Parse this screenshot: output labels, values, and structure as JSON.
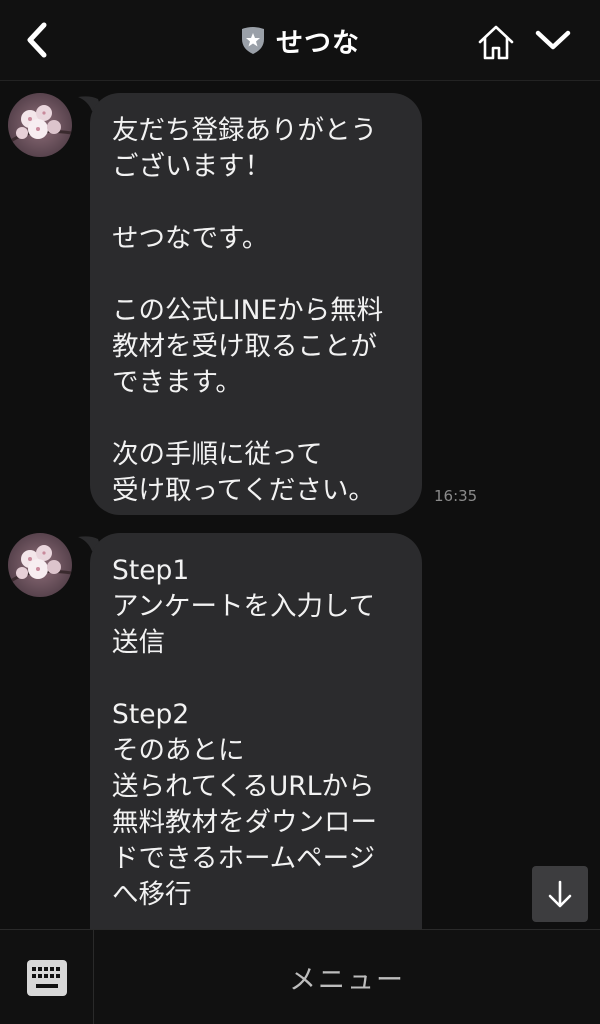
{
  "header": {
    "title": "せつな",
    "icons": {
      "back": "chevron-left-icon",
      "badge": "star-shield-icon",
      "home": "home-icon",
      "expand": "chevron-down-icon"
    }
  },
  "messages": [
    {
      "text": "友だち登録ありがとう\nございます！\n\nせつなです。\n\nこの公式LINEから無料\n教材を受け取ることが\nできます。\n\n次の手順に従って\n受け取ってください。",
      "time": "16:35"
    },
    {
      "text": "Step1\nアンケートを入力して\n送信\n\nStep2\nそのあとに\n送られてくるURLから\n無料教材をダウンロー\nドできるホームページ\nへ移行",
      "time": ""
    }
  ],
  "bottom_bar": {
    "menu_label": "メニュー",
    "keyboard_icon": "keyboard-icon"
  },
  "scroll_button_icon": "arrow-down-icon",
  "colors": {
    "background": "#0f0f0f",
    "bubble": "#2b2b2d",
    "badge": "#9aa0a8"
  }
}
